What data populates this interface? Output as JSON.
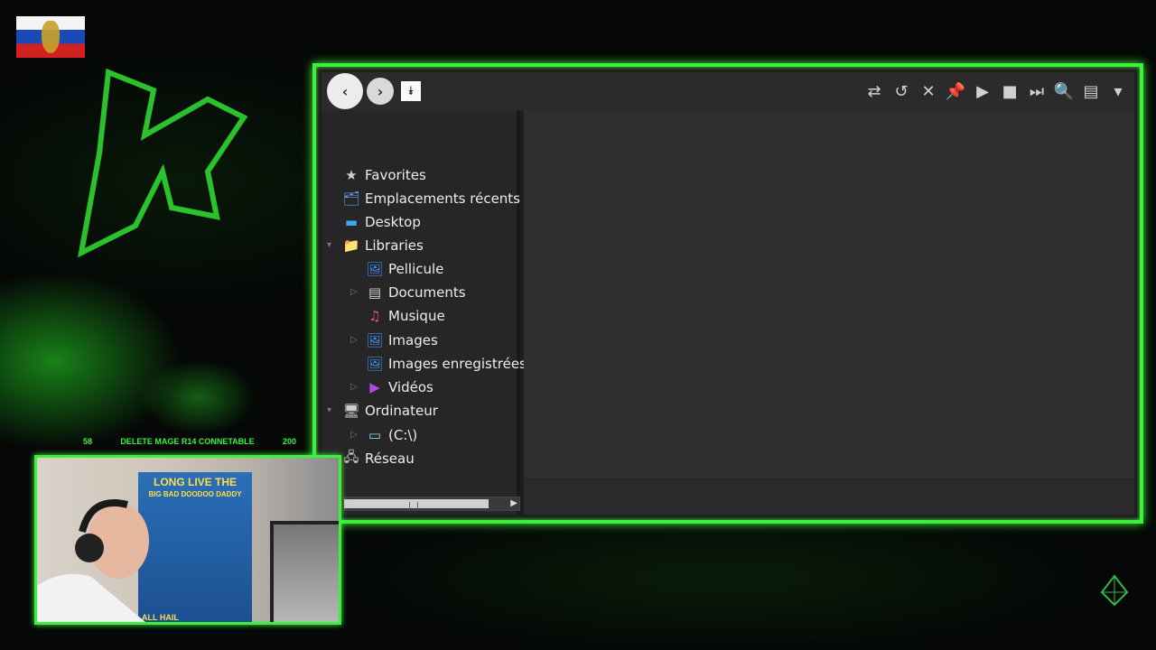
{
  "toolbar": {
    "back_icon": "chevron-left-icon",
    "forward_icon": "chevron-right-icon",
    "menu_icon": "double-chevron-down-icon",
    "back_glyph": "‹",
    "forward_glyph": "›",
    "menu_glyph": "⯯",
    "tools": [
      {
        "name": "copy-move-icon",
        "glyph": "⇄"
      },
      {
        "name": "undo-icon",
        "glyph": "↺"
      },
      {
        "name": "delete-icon",
        "glyph": "✕"
      },
      {
        "name": "pin-icon",
        "glyph": "📌"
      },
      {
        "name": "play-icon",
        "glyph": "▶"
      },
      {
        "name": "stop-icon",
        "glyph": "■"
      },
      {
        "name": "next-icon",
        "glyph": "⏭"
      },
      {
        "name": "search-icon",
        "glyph": "🔍"
      },
      {
        "name": "view-icon",
        "glyph": "▤"
      },
      {
        "name": "dropdown-icon",
        "glyph": "▾"
      }
    ]
  },
  "sidebar": {
    "items": [
      {
        "label": "Favorites",
        "icon": "star-icon"
      },
      {
        "label": "Emplacements récents",
        "icon": "recent-places-icon"
      },
      {
        "label": "Desktop",
        "icon": "desktop-icon"
      },
      {
        "label": "Libraries",
        "icon": "folder-icon"
      },
      {
        "label": "Pellicule",
        "icon": "pictures-icon"
      },
      {
        "label": "Documents",
        "icon": "documents-icon"
      },
      {
        "label": "Musique",
        "icon": "music-icon"
      },
      {
        "label": "Images",
        "icon": "pictures-icon"
      },
      {
        "label": "Images enregistrées",
        "icon": "pictures-icon"
      },
      {
        "label": "Vidéos",
        "icon": "videos-icon"
      },
      {
        "label": "Ordinateur",
        "icon": "computer-icon"
      },
      {
        "label": "(C:\\)",
        "icon": "drive-icon"
      },
      {
        "label": "Réseau",
        "icon": "network-icon"
      }
    ]
  },
  "overlay": {
    "stat_left": "58",
    "stat_middle": "DELETE MAGE R14 CONNETABLE",
    "stat_right": "200"
  },
  "webcam": {
    "poster_title": "LONG LIVE THE",
    "poster_subtitle": "BIG BAD DOODOO DADDY",
    "poster_bottom": "ALL HAIL"
  },
  "colors": {
    "accent": "#3cf03c",
    "window_bg": "#2f2f2f",
    "sidebar_bg": "#262626"
  }
}
